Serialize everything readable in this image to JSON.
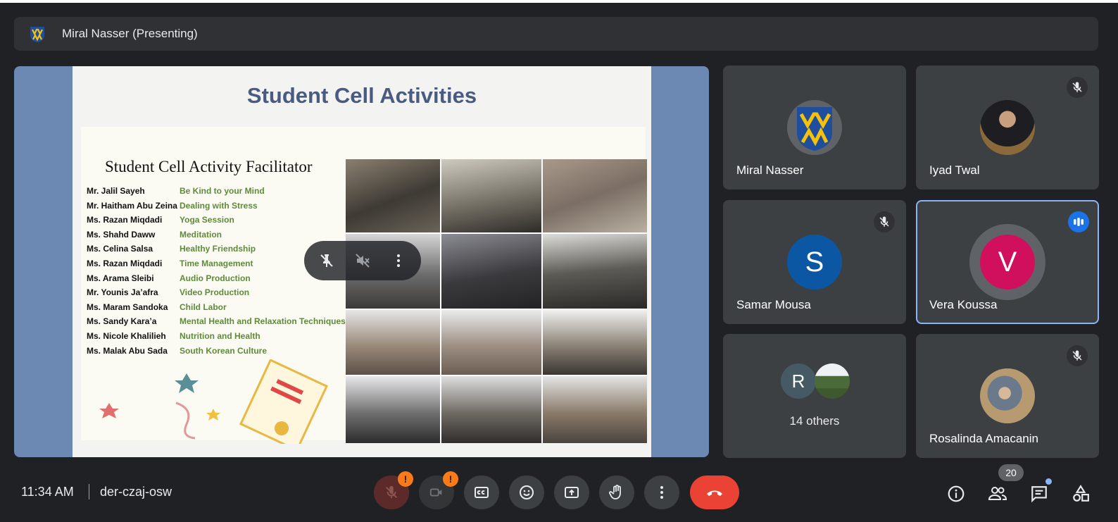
{
  "presenter_bar": {
    "title": "Miral Nasser (Presenting)"
  },
  "slide": {
    "title": "Student Cell Activities",
    "facilitator_title": "Student Cell Activity Facilitator",
    "rows": [
      {
        "name": "Mr. Jalil Sayeh",
        "activity": "Be Kind to your Mind"
      },
      {
        "name": "Mr. Haitham Abu Zeina",
        "activity": "Dealing with Stress"
      },
      {
        "name": "Ms. Razan Miqdadi",
        "activity": "Yoga Session"
      },
      {
        "name": "Ms.  Shahd Daww",
        "activity": "Meditation"
      },
      {
        "name": "Ms.  Celina Salsa",
        "activity": "Healthy Friendship"
      },
      {
        "name": "Ms.  Razan Miqdadi",
        "activity": "Time Management"
      },
      {
        "name": "Ms.  Arama Sleibi",
        "activity": "Audio Production"
      },
      {
        "name": "Mr. Younis Ja’afra",
        "activity": "Video Production"
      },
      {
        "name": "Ms.  Maram Sandoka",
        "activity": "Child Labor"
      },
      {
        "name": "Ms.  Sandy Kara’a",
        "activity": "Mental Health and Relaxation Techniques"
      },
      {
        "name": "Ms.  Nicole Khalilieh",
        "activity": "Nutrition and Health"
      },
      {
        "name": "Ms. Malak Abu Sada",
        "activity": "South Korean Culture"
      }
    ]
  },
  "participants": [
    {
      "name": "Miral Nasser",
      "avatar": "logo",
      "muted": false
    },
    {
      "name": "Iyad Twal",
      "avatar": "photo",
      "muted": true
    },
    {
      "name": "Samar Mousa",
      "avatar": "S",
      "avatar_color": "#0b57a4",
      "muted": true
    },
    {
      "name": "Vera Koussa",
      "avatar": "V",
      "avatar_color": "#d0105c",
      "speaking": true
    },
    {
      "name": "14 others",
      "avatar": "R"
    },
    {
      "name": "Rosalinda Amacanin",
      "avatar": "photo",
      "muted": true
    }
  ],
  "bottom": {
    "time": "11:34 AM",
    "meeting_code": "der-czaj-osw",
    "participant_count": "20",
    "badge_mark": "!"
  },
  "colors": {
    "accent": "#8ab4f8",
    "end_call": "#ea4335",
    "warning": "#fa7b17",
    "stage_bg": "#6c89b3"
  }
}
